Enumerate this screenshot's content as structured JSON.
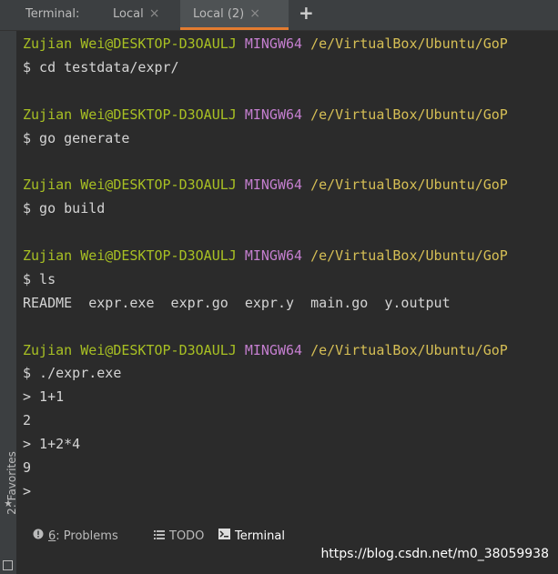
{
  "tabbar": {
    "title": "Terminal:",
    "tabs": [
      {
        "label": "Local"
      },
      {
        "label": "Local (2)"
      }
    ],
    "close_glyph": "×",
    "add_glyph": "+"
  },
  "sidebar": {
    "favorites_label": "2: Favorites",
    "star_glyph": "★"
  },
  "prompt": {
    "user": "Zujian Wei@DESKTOP-D3OAULJ",
    "system": "MINGW64",
    "path": "/e/VirtualBox/Ubuntu/GoP"
  },
  "session": [
    {
      "command": "$ cd testdata/expr/",
      "output": []
    },
    {
      "command": "$ go generate",
      "output": []
    },
    {
      "command": "$ go build",
      "output": []
    },
    {
      "command": "$ ls",
      "output": [
        "README  expr.exe  expr.go  expr.y  main.go  y.output"
      ]
    },
    {
      "command": "$ ./expr.exe",
      "output": [
        "> 1+1",
        "2",
        "> 1+2*4",
        "9",
        ">"
      ]
    }
  ],
  "bottom_tabs": [
    {
      "number": "6",
      "label": ": Problems",
      "icon": "problems-icon"
    },
    {
      "label": "TODO",
      "icon": "todo-icon"
    },
    {
      "label": "Terminal",
      "icon": "terminal-icon"
    }
  ],
  "watermark": "https://blog.csdn.net/m0_38059938",
  "colors": {
    "background": "#2b2b2b",
    "user": "#a8c023",
    "system": "#c57fd0",
    "path": "#d6bf55",
    "active_tab_underline": "#e37c30"
  }
}
